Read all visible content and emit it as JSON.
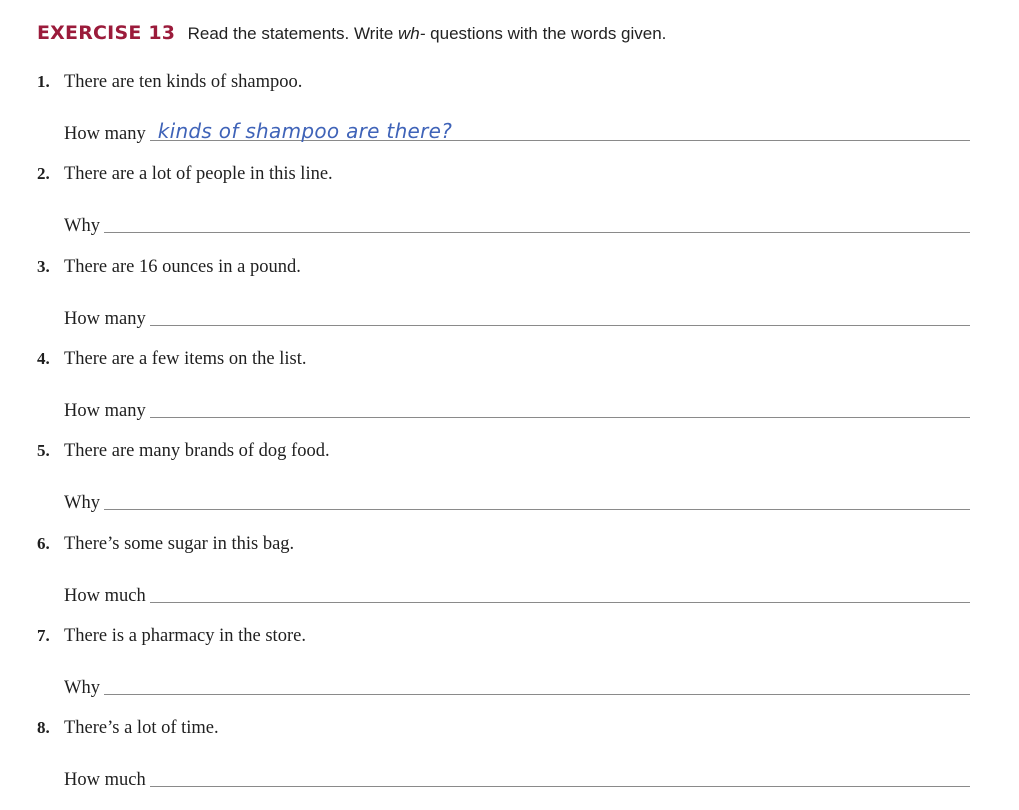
{
  "exercise": {
    "label": "EXERCISE 13",
    "label_color": "#9b1b3b",
    "instruction_before": "Read the statements. Write ",
    "instruction_italic": "wh-",
    "instruction_after": " questions with the words given."
  },
  "items": [
    {
      "number": "1.",
      "statement": "There are ten kinds of shampoo.",
      "prompt": "How many",
      "answer": "kinds of shampoo are there?"
    },
    {
      "number": "2.",
      "statement": "There are a lot of people in this line.",
      "prompt": "Why",
      "answer": ""
    },
    {
      "number": "3.",
      "statement": "There are 16 ounces in a pound.",
      "prompt": "How many",
      "answer": ""
    },
    {
      "number": "4.",
      "statement": "There are a few items on the list.",
      "prompt": "How many",
      "answer": ""
    },
    {
      "number": "5.",
      "statement": "There are many brands of dog food.",
      "prompt": "Why",
      "answer": ""
    },
    {
      "number": "6.",
      "statement": "There’s some sugar in this bag.",
      "prompt": "How much",
      "answer": ""
    },
    {
      "number": "7.",
      "statement": "There is a pharmacy in the store.",
      "prompt": "Why",
      "answer": ""
    },
    {
      "number": "8.",
      "statement": "There’s a lot of time.",
      "prompt": "How much",
      "answer": ""
    }
  ],
  "colors": {
    "answer_ink": "#3f63b8",
    "answer_line": "#8a8a8a"
  }
}
